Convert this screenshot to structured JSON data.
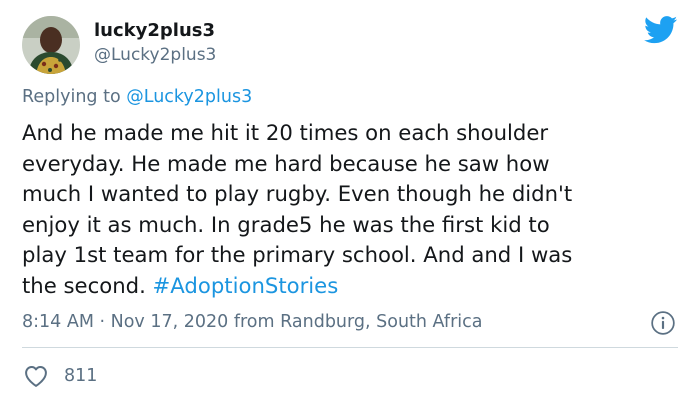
{
  "author": {
    "display_name": "lucky2plus3",
    "handle": "@Lucky2plus3"
  },
  "reply": {
    "prefix": "Replying to",
    "mention": "@Lucky2plus3"
  },
  "tweet": {
    "text": "And he made me hit it 20 times on each shoulder\neveryday. He made me hard because he saw how\nmuch I wanted to play rugby. Even though he didn't\nenjoy it as much. In grade5 he was the first kid to\nplay 1st team for the primary school. And and I was\nthe second. ",
    "hashtag": "#AdoptionStories"
  },
  "meta": {
    "text": "8:14 AM · Nov 17, 2020 from Randburg, South Africa"
  },
  "engagement": {
    "likes": "811"
  },
  "icons": {
    "brand": "twitter-bird-icon",
    "info": "info-icon",
    "like": "heart-icon"
  },
  "colors": {
    "brand": "#1da1f2",
    "link": "#1b95e0",
    "secondary_text": "#5b7083",
    "divider": "#cfd9de"
  }
}
